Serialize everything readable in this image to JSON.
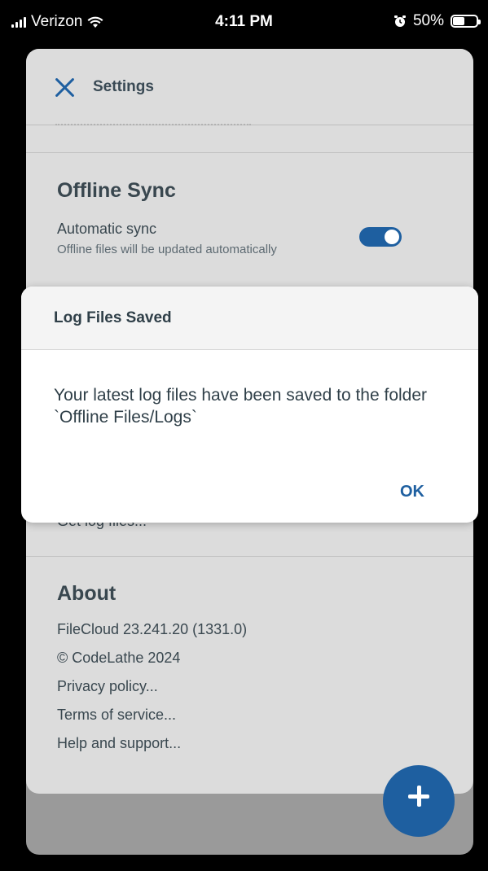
{
  "status_bar": {
    "carrier": "Verizon",
    "time": "4:11 PM",
    "battery_percent": "50%",
    "battery_level": 0.5
  },
  "settings": {
    "title": "Settings",
    "offline_sync": {
      "title": "Offline Sync",
      "automatic_sync_label": "Automatic sync",
      "automatic_sync_desc": "Offline files will be updated automatically",
      "automatic_sync_on": true
    },
    "partial_row": "Get log files...",
    "about": {
      "title": "About",
      "lines": [
        "FileCloud 23.241.20 (1331.0)",
        "© CodeLathe 2024",
        "Privacy policy...",
        "Terms of service...",
        "Help and support..."
      ]
    }
  },
  "dialog": {
    "title": "Log Files Saved",
    "message": "Your latest log files have been saved to the folder `Offline Files/Logs`",
    "ok_label": "OK"
  },
  "colors": {
    "accent": "#1e5fa0"
  }
}
